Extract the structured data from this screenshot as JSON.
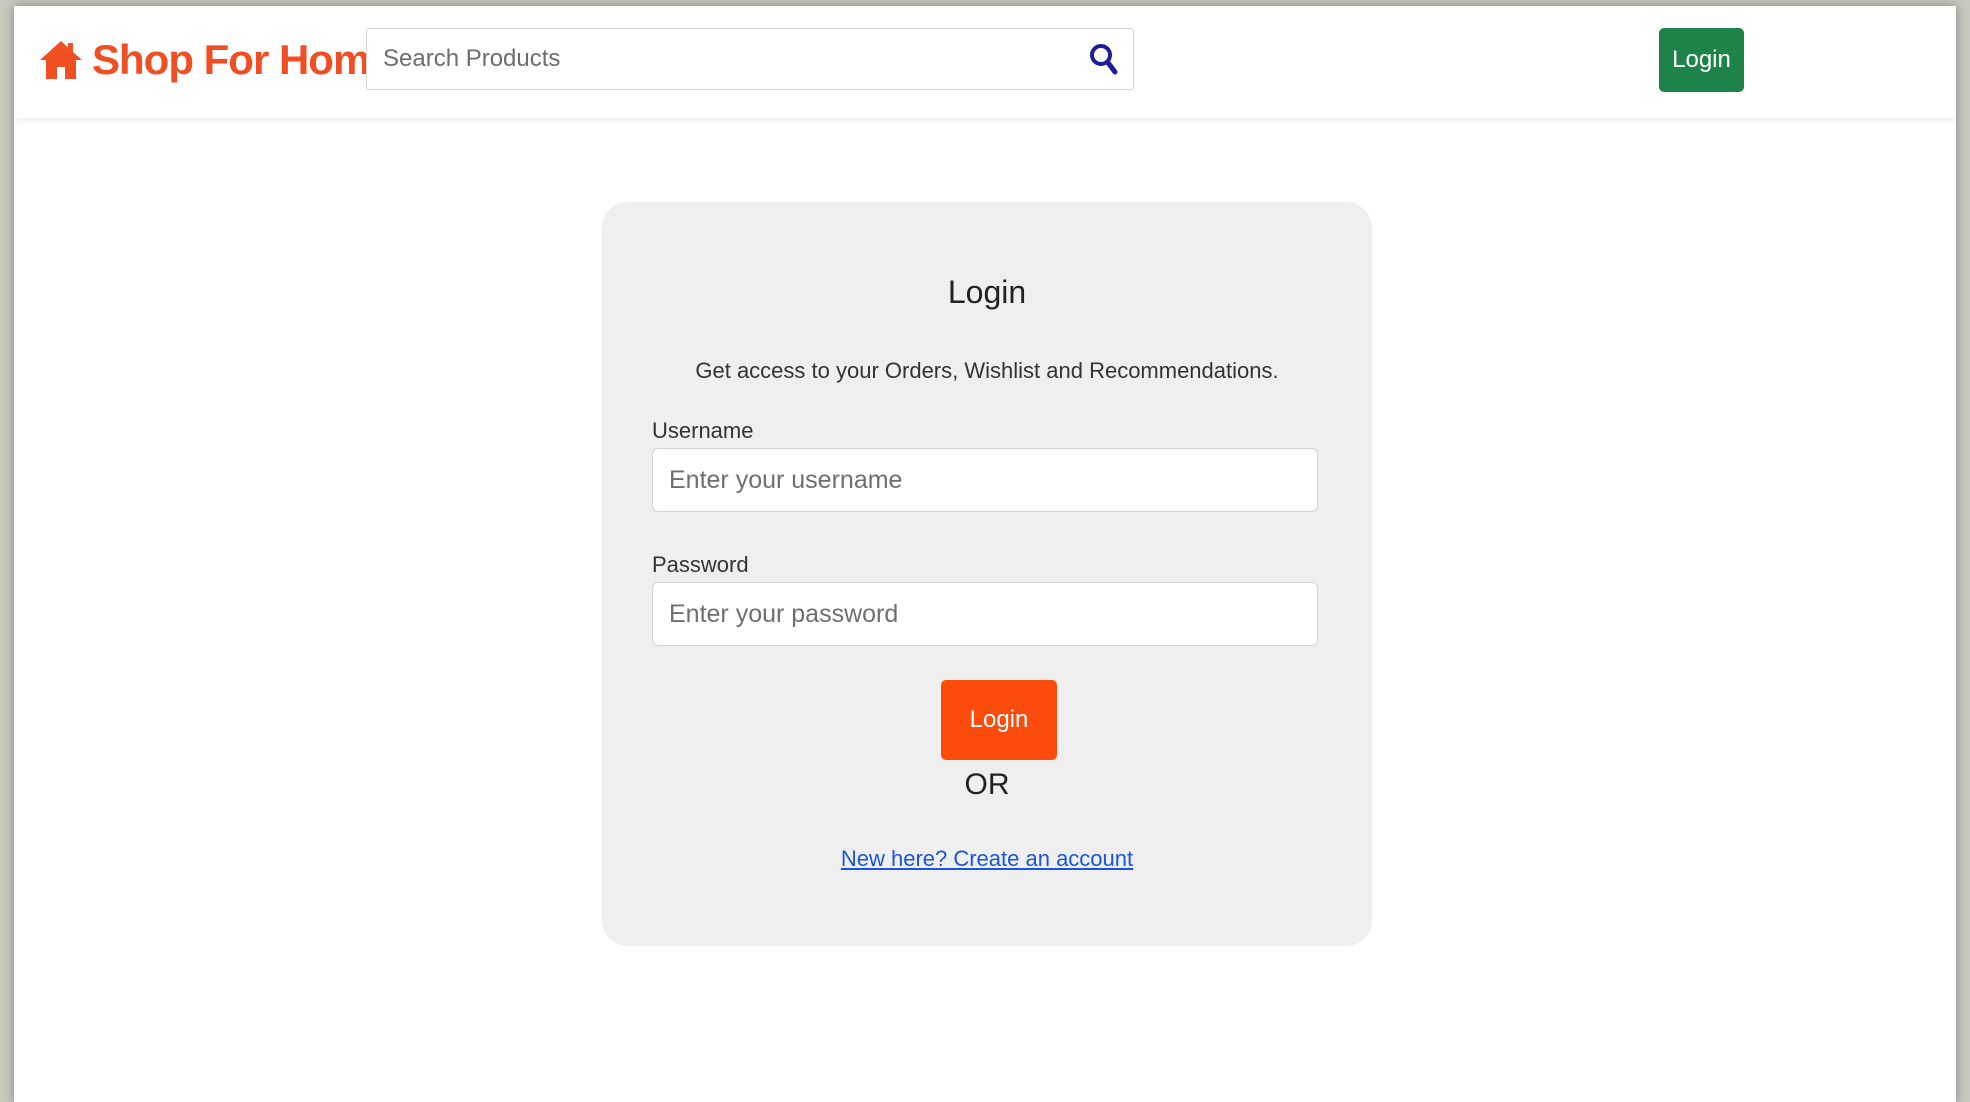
{
  "brand": {
    "name": "Shop For Home",
    "icon": "home-icon",
    "color": "#f04e23"
  },
  "search": {
    "placeholder": "Search Products",
    "value": "",
    "icon": "search-icon",
    "icon_color": "#1c1c9c"
  },
  "navbar": {
    "login_label": "Login",
    "login_color": "#1d8348"
  },
  "login_card": {
    "title": "Login",
    "subtitle": "Get access to your Orders, Wishlist and Recommendations.",
    "username_label": "Username",
    "username_placeholder": "Enter your username",
    "username_value": "",
    "password_label": "Password",
    "password_placeholder": "Enter your password",
    "password_value": "",
    "submit_label": "Login",
    "submit_color": "#fb4b0d",
    "or_text": "OR",
    "create_account_link": "New here? Create an account"
  }
}
